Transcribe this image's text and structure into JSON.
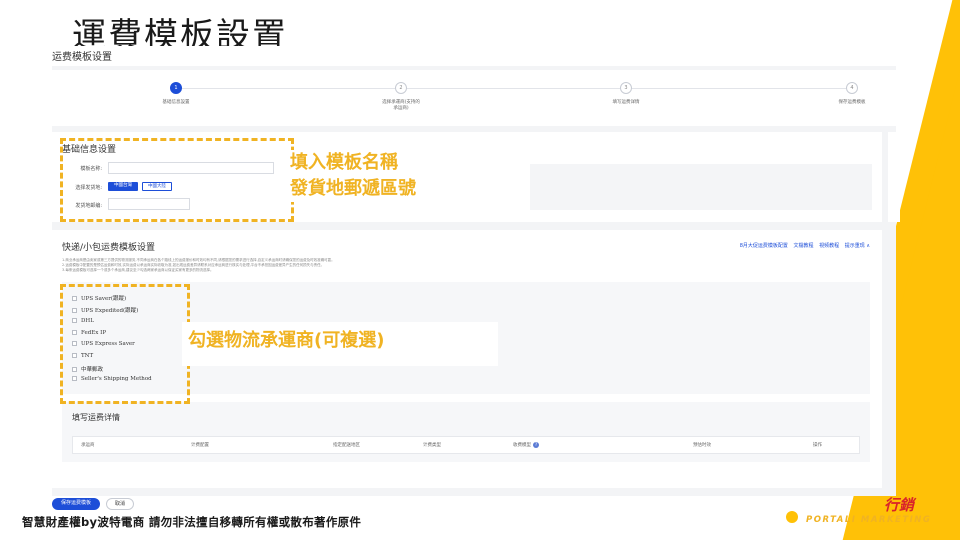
{
  "slide": {
    "title": "運費模板設置"
  },
  "page": {
    "header_title": "运费模板设置"
  },
  "steps": [
    {
      "num": "1",
      "label": "基础信息設置"
    },
    {
      "num": "2",
      "label": "选择承運商(支持的承运商)"
    },
    {
      "num": "3",
      "label": "填写运费详情"
    },
    {
      "num": "4",
      "label": "保存运费模板"
    }
  ],
  "basic": {
    "title": "基础信息设置",
    "template_name_label": "模板名称:",
    "ship_from_label": "选择发货地:",
    "ship_from_primary": "中國台灣",
    "ship_from_secondary": "中國大陸",
    "postcode_label": "发货地邮编:"
  },
  "shipping": {
    "title": "快递/小包运费模板设置",
    "links": [
      "8月大促运费模板配置",
      "文檔教程",
      "視频教程",
      "提示重现 ∧"
    ],
    "notes": [
      "1.商业承运商是由卖家或第三方提供的物流服务,不同承运商在各个路线上的运费报价和时效均有不同,请根据您的需求进行选择,自定义承运商时请确保您的运费及时效准确可靠。",
      "2.运费模板中配置的是预估运费和时效,实际运费以承运商实际收取为准,如出现运费差异请联系对应承运商进行核实与处理,平台不承担因运费差异产生的任何损失与责任。",
      "3.每条运费模板可选择一个或多个承运商,建议至少勾选两家承运商以保证买家有更多的物流选择。"
    ],
    "carriers": [
      "UPS Saver(跟蹤)",
      "UPS Expedited(跟蹤)",
      "DHL",
      "FedEx IP",
      "UPS Express Saver",
      "TNT",
      "中華郵政",
      "Seller's Shipping Method"
    ]
  },
  "details": {
    "title": "填写运费详情",
    "columns": [
      "承运商",
      "计费配置",
      "指定配送地区",
      "计费类型",
      "收费模型",
      "预估时效",
      "操作"
    ]
  },
  "buttons": {
    "save": "保存运费模板",
    "cancel": "取消"
  },
  "annotations": {
    "name_postcode_line1": "填入模板名稱",
    "name_postcode_line2": "發貨地郵遞區號",
    "carriers": "勾選物流承運商(可複選)"
  },
  "footer": {
    "copyright": "智慧財產權by波特電商 請勿非法擅自移轉所有權或散布著作原件",
    "brand_text": "PORTALI MARKETING",
    "brand_cn": "行銷"
  },
  "colors": {
    "accent": "#ffc107",
    "primary": "#1d4ed8",
    "annotation": "#f0b323"
  }
}
